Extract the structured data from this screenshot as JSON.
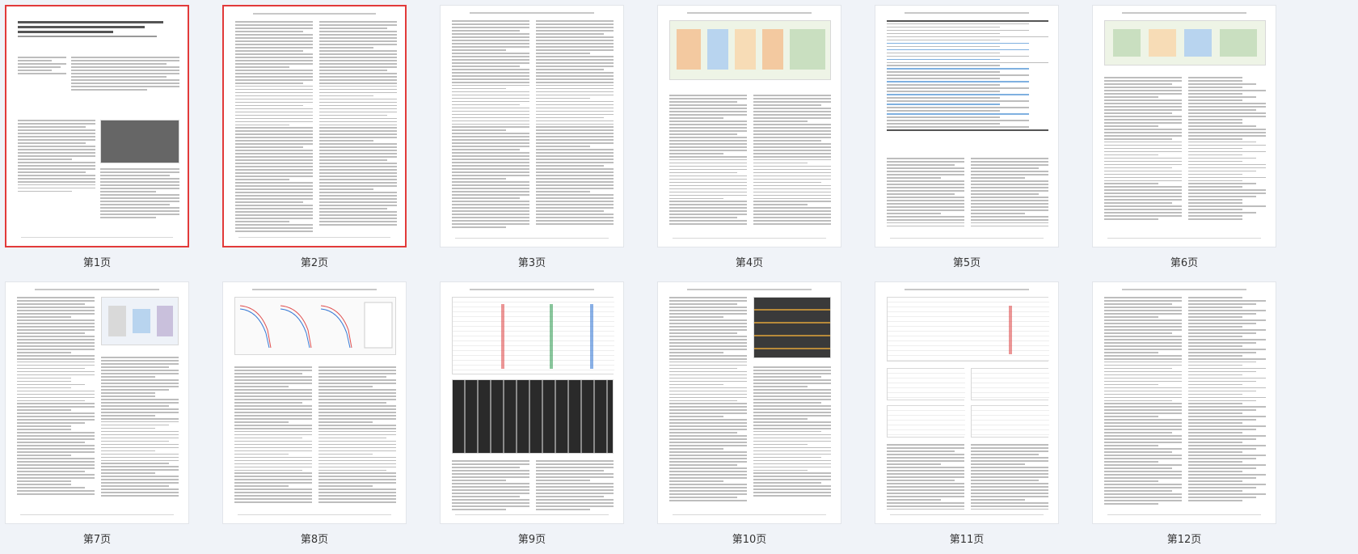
{
  "pages": [
    {
      "label": "第1页",
      "selected": true
    },
    {
      "label": "第2页",
      "selected": true
    },
    {
      "label": "第3页",
      "selected": false
    },
    {
      "label": "第4页",
      "selected": false
    },
    {
      "label": "第5页",
      "selected": false
    },
    {
      "label": "第6页",
      "selected": false
    },
    {
      "label": "第7页",
      "selected": false
    },
    {
      "label": "第8页",
      "selected": false
    },
    {
      "label": "第9页",
      "selected": false
    },
    {
      "label": "第10页",
      "selected": false
    },
    {
      "label": "第11页",
      "selected": false
    },
    {
      "label": "第12页",
      "selected": false
    }
  ],
  "colors": {
    "background": "#f0f3f8",
    "selected_border": "#e23a3a",
    "page": "#ffffff"
  }
}
